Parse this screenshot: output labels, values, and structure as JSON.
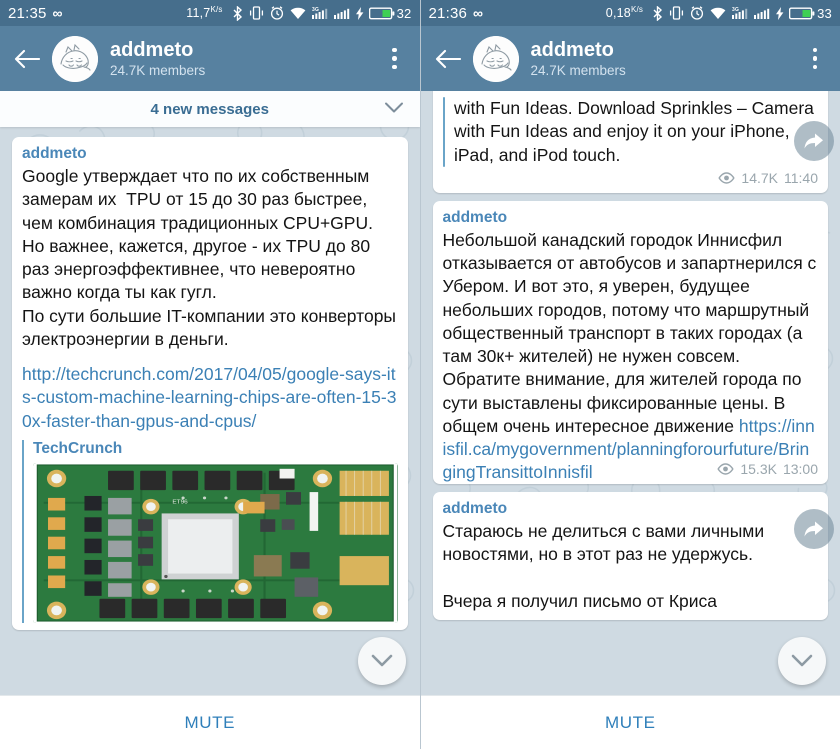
{
  "panes": [
    {
      "status": {
        "time": "21:35",
        "infinity_icon": "infinity-icon",
        "net_speed": "11,7",
        "net_unit_top": "K",
        "net_unit_bottom": "s",
        "bluetooth_icon": "bluetooth-icon",
        "vibrate_icon": "vibrate-icon",
        "alarm_icon": "alarm-clock-icon",
        "wifi_icon": "wifi-icon",
        "sim1_icon": "signal-3g-icon",
        "sim2_icon": "signal-bars-icon",
        "charge_icon": "charging-bolt-icon",
        "battery_icon": "battery-icon",
        "battery_pct": "32"
      },
      "appbar": {
        "back_icon": "back-arrow-icon",
        "avatar_icon": "sleeping-cat-avatar",
        "title": "addmeto",
        "subtitle": "24.7K members",
        "menu_icon": "overflow-menu-icon"
      },
      "new_messages_bar": {
        "label": "4 new messages",
        "chevron_icon": "chevron-down-icon",
        "visible": true
      },
      "messages": [
        {
          "author": "addmeto",
          "text": "Google утверждает что по их собственным замерам их  TPU от 15 до 30 раз быстрее, чем комбинация традиционных CPU+GPU. Но важнее, кажется, другое - их TPU до 80 раз энергоэффективнее, что невероятно важно когда ты как гугл.\nПо сути большие IT-компании это конверторы электроэнергии в деньги.",
          "link": "http://techcrunch.com/2017/04/05/google-says-its-custom-machine-learning-chips-are-often-15-30x-faster-than-gpus-and-cpus/",
          "preview_site": "TechCrunch",
          "preview_image": "google-tpu-circuit-board-photo",
          "views": "",
          "time": ""
        }
      ],
      "scroll_down_icon": "chevron-down-icon",
      "mute_label": "MUTE"
    },
    {
      "status": {
        "time": "21:36",
        "infinity_icon": "infinity-icon",
        "net_speed": "0,18",
        "net_unit_top": "K",
        "net_unit_bottom": "s",
        "bluetooth_icon": "bluetooth-icon",
        "vibrate_icon": "vibrate-icon",
        "alarm_icon": "alarm-clock-icon",
        "wifi_icon": "wifi-icon",
        "sim1_icon": "signal-3g-icon",
        "sim2_icon": "signal-bars-icon",
        "charge_icon": "charging-bolt-icon",
        "battery_icon": "battery-icon",
        "battery_pct": "33"
      },
      "appbar": {
        "back_icon": "back-arrow-icon",
        "avatar_icon": "sleeping-cat-avatar",
        "title": "addmeto",
        "subtitle": "24.7K members",
        "menu_icon": "overflow-menu-icon"
      },
      "new_messages_bar": {
        "label": "",
        "chevron_icon": "chevron-down-icon",
        "visible": false
      },
      "messages": [
        {
          "author": "",
          "text": "with Fun Ideas. Download Sprinkles – Camera with Fun Ideas and enjoy it on your iPhone, iPad, and iPod touch.",
          "link": "",
          "preview_site": "",
          "preview_image": "",
          "views": "14.7K",
          "time": "11:40"
        },
        {
          "author": "addmeto",
          "text": "Небольшой канадский городок Иннисфил отказывается от автобусов и запартнерился с Убером. И вот это, я уверен, будущее небольших городов, потому что маршрутный общественный транспорт в таких городах (а там 30к+ жителей) не нужен совсем. Обратите внимание, для жителей города по сути выставлены фиксированные цены. В общем очень интересное движение ",
          "link": "https://innisfil.ca/mygovernment/planningforourfuture/BringingTransittoInnisfil",
          "preview_site": "",
          "preview_image": "",
          "views": "15.3K",
          "time": "13:00"
        },
        {
          "author": "addmeto",
          "text": "Стараюсь не делиться с вами личными новостями, но в этот раз не удержусь.\n\nВчера я получил письмо от Криса",
          "link": "",
          "preview_site": "",
          "preview_image": "",
          "views": "",
          "time": ""
        }
      ],
      "share_icon": "forward-share-icon",
      "scroll_down_icon": "chevron-down-icon",
      "mute_label": "MUTE"
    }
  ],
  "colors": {
    "statusbar": "#466e8c",
    "appbar": "#5781a0",
    "chat_background": "#cfdae2",
    "bubble": "#ffffff",
    "author": "#4a87b8",
    "link": "#3b80b5",
    "mute": "#2f7fba",
    "battery_fill": "#3ecf55"
  }
}
